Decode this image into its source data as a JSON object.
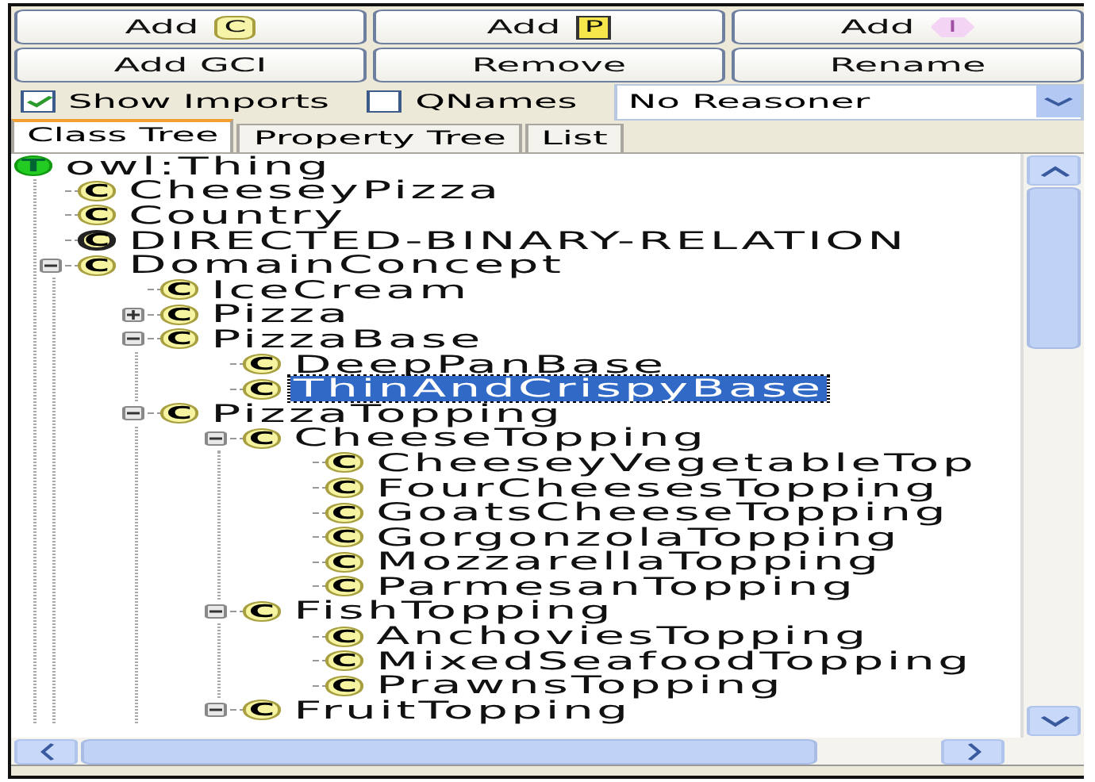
{
  "buttons": [
    {
      "label": "Add",
      "badge": "C",
      "kind": "class"
    },
    {
      "label": "Add",
      "badge": "P",
      "kind": "property"
    },
    {
      "label": "Add",
      "badge": "I",
      "kind": "individual"
    },
    {
      "label": "Add GCI",
      "kind": "plain"
    },
    {
      "label": "Remove",
      "kind": "plain"
    },
    {
      "label": "Rename",
      "kind": "plain"
    }
  ],
  "options": [
    {
      "label": "Show Imports",
      "checked": true
    },
    {
      "label": "QNames",
      "checked": false
    }
  ],
  "reasoner": {
    "value": "No Reasoner"
  },
  "tabs": [
    {
      "label": "Class Tree",
      "selected": true
    },
    {
      "label": "Property Tree",
      "selected": false
    },
    {
      "label": "List",
      "selected": false
    }
  ],
  "tree": [
    {
      "label": "owl:Thing",
      "badge": "T",
      "kind": "thing",
      "selected": false,
      "children": [
        {
          "label": "CheeseyPizza",
          "badge": "C",
          "kind": "class",
          "selected": false
        },
        {
          "label": "Country",
          "badge": "C",
          "kind": "class",
          "selected": false
        },
        {
          "label": "DIRECTED-BINARY-RELATION",
          "badge": "C",
          "kind": "defined",
          "selected": false
        },
        {
          "label": "DomainConcept",
          "badge": "C",
          "kind": "class",
          "selected": false,
          "expanded": true,
          "children": [
            {
              "label": "IceCream",
              "badge": "C",
              "kind": "class",
              "selected": false
            },
            {
              "label": "Pizza",
              "badge": "C",
              "kind": "class",
              "selected": false,
              "expanded": false
            },
            {
              "label": "PizzaBase",
              "badge": "C",
              "kind": "class",
              "selected": false,
              "expanded": true,
              "children": [
                {
                  "label": "DeepPanBase",
                  "badge": "C",
                  "kind": "class",
                  "selected": false
                },
                {
                  "label": "ThinAndCrispyBase",
                  "badge": "C",
                  "kind": "class",
                  "selected": true
                }
              ]
            },
            {
              "label": "PizzaTopping",
              "badge": "C",
              "kind": "class",
              "selected": false,
              "expanded": true,
              "children": [
                {
                  "label": "CheeseTopping",
                  "badge": "C",
                  "kind": "class",
                  "selected": false,
                  "expanded": true,
                  "children": [
                    {
                      "label": "CheeseyVegetableTop",
                      "badge": "C",
                      "kind": "class",
                      "selected": false
                    },
                    {
                      "label": "FourCheesesTopping",
                      "badge": "C",
                      "kind": "class",
                      "selected": false
                    },
                    {
                      "label": "GoatsCheeseTopping",
                      "badge": "C",
                      "kind": "class",
                      "selected": false
                    },
                    {
                      "label": "GorgonzolaTopping",
                      "badge": "C",
                      "kind": "class",
                      "selected": false
                    },
                    {
                      "label": "MozzarellaTopping",
                      "badge": "C",
                      "kind": "class",
                      "selected": false
                    },
                    {
                      "label": "ParmesanTopping",
                      "badge": "C",
                      "kind": "class",
                      "selected": false
                    }
                  ]
                },
                {
                  "label": "FishTopping",
                  "badge": "C",
                  "kind": "class",
                  "selected": false,
                  "expanded": true,
                  "children": [
                    {
                      "label": "AnchoviesTopping",
                      "badge": "C",
                      "kind": "class",
                      "selected": false
                    },
                    {
                      "label": "MixedSeafoodTopping",
                      "badge": "C",
                      "kind": "class",
                      "selected": false
                    },
                    {
                      "label": "PrawnsTopping",
                      "badge": "C",
                      "kind": "class",
                      "selected": false
                    }
                  ]
                },
                {
                  "label": "FruitTopping",
                  "badge": "C",
                  "kind": "class",
                  "selected": false,
                  "expanded": true
                }
              ]
            }
          ]
        }
      ]
    }
  ]
}
